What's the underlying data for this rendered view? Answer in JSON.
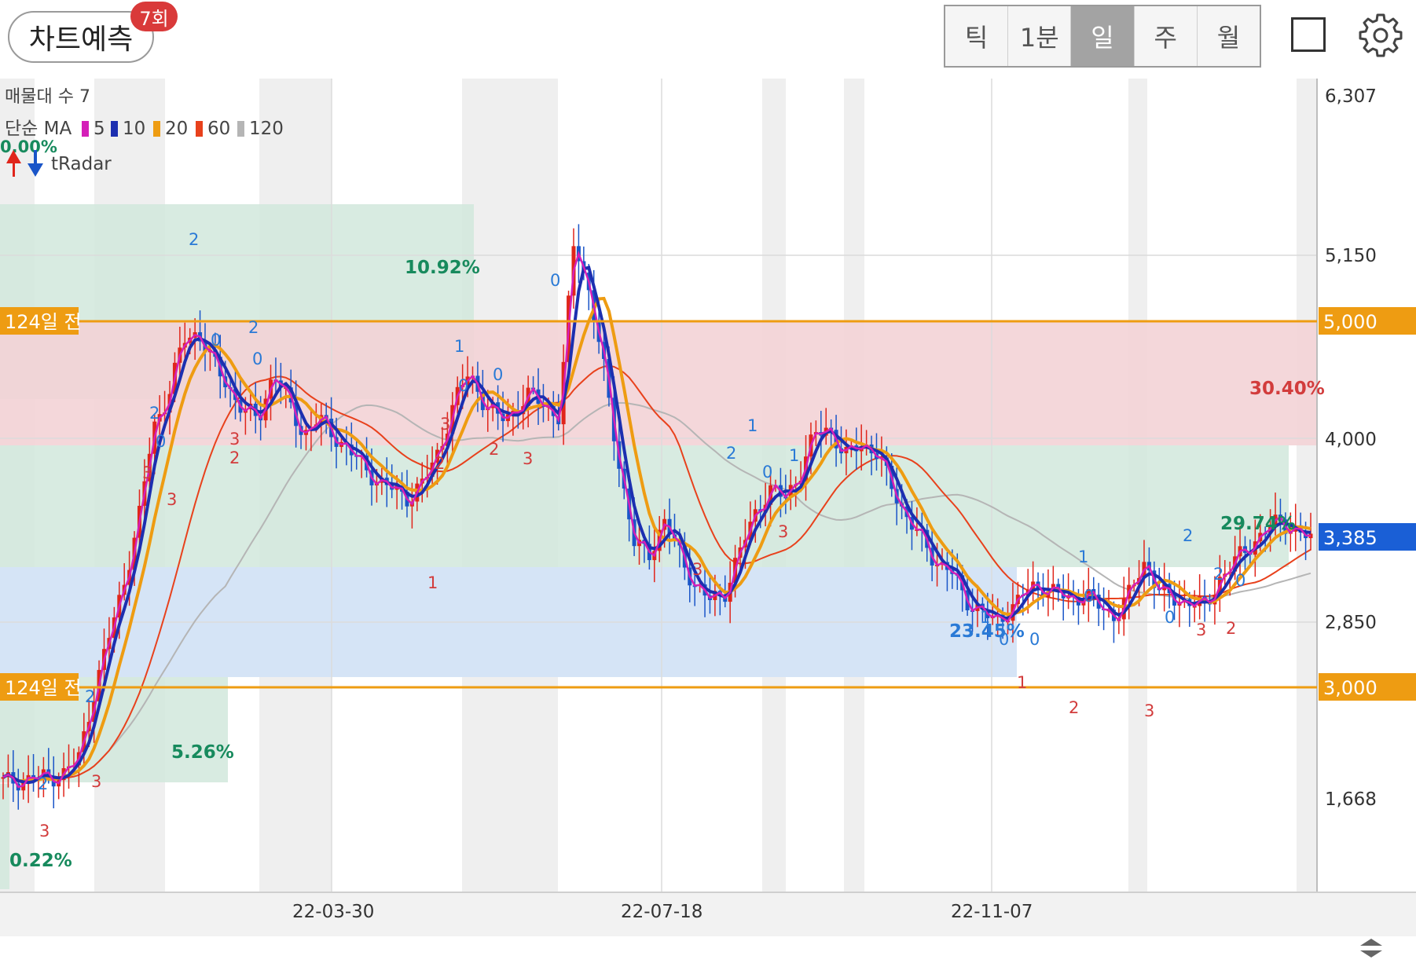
{
  "header": {
    "predict_label": "차트예측",
    "predict_badge": "7회",
    "periods": [
      "틱",
      "1분",
      "일",
      "주",
      "월"
    ],
    "active_period": "일"
  },
  "legend": {
    "line1": "매물대 수 7",
    "ma_prefix": "단순 MA",
    "ma_items": [
      {
        "label": "5",
        "color": "#d41fb8"
      },
      {
        "label": "10",
        "color": "#1c2fb0"
      },
      {
        "label": "20",
        "color": "#ee9c12"
      },
      {
        "label": "60",
        "color": "#e8411c"
      },
      {
        "label": "120",
        "color": "#b5b5b5"
      }
    ],
    "tradar": "tRadar",
    "tradar_pct": "0.00%"
  },
  "price_axis": {
    "ticks": [
      "6,307",
      "5,150",
      "4,000",
      "2,850",
      "1,668"
    ],
    "current_price": "3,385",
    "line_5000": "5,000",
    "line_3000": "3,000"
  },
  "date_axis": [
    "22-03-30",
    "22-07-18",
    "22-11-07"
  ],
  "annotations": {
    "line_label_upper": "124일 전",
    "line_label_lower": "124일 전",
    "pct_1092": "10.92%",
    "pct_3040": "30.40%",
    "pct_2974": "29.74%",
    "pct_2345": "23.45%",
    "pct_526": "5.26%",
    "pct_022": "0.22%"
  },
  "colors": {
    "up": "#e0251b",
    "down": "#1a55c8",
    "ma5": "#d41fb8",
    "ma10": "#1c2fb0",
    "ma20": "#ee9c12",
    "ma60": "#e8411c",
    "ma120": "#b5b5b5",
    "level_line": "#ee9c12",
    "current_price_bg": "#1a5fd6"
  },
  "chart_data": {
    "type": "candlestick",
    "y_range": [
      1668,
      6307
    ],
    "close_series": [
      1850,
      1860,
      1870,
      1880,
      1900,
      1990,
      2400,
      2750,
      3100,
      3500,
      4100,
      4300,
      4650,
      4700,
      4500,
      4350,
      4200,
      4150,
      4450,
      4250,
      4050,
      4150,
      4050,
      3950,
      3850,
      3750,
      3700,
      3650,
      3750,
      3950,
      4250,
      4450,
      4250,
      4150,
      4200,
      4300,
      4250,
      4150,
      5300,
      4950,
      4450,
      3850,
      3350,
      3300,
      3500,
      3300,
      3100,
      3000,
      3050,
      3300,
      3550,
      3700,
      3650,
      3800,
      4050,
      4100,
      3900,
      4000,
      3950,
      3750,
      3550,
      3400,
      3250,
      3200,
      3000,
      2950,
      2850,
      2950,
      3050,
      3100,
      3050,
      3000,
      3050,
      2950,
      2900,
      3050,
      3250,
      3050,
      3000,
      3000,
      2950,
      3150,
      3250,
      3350,
      3450,
      3500,
      3450,
      3380
    ]
  }
}
